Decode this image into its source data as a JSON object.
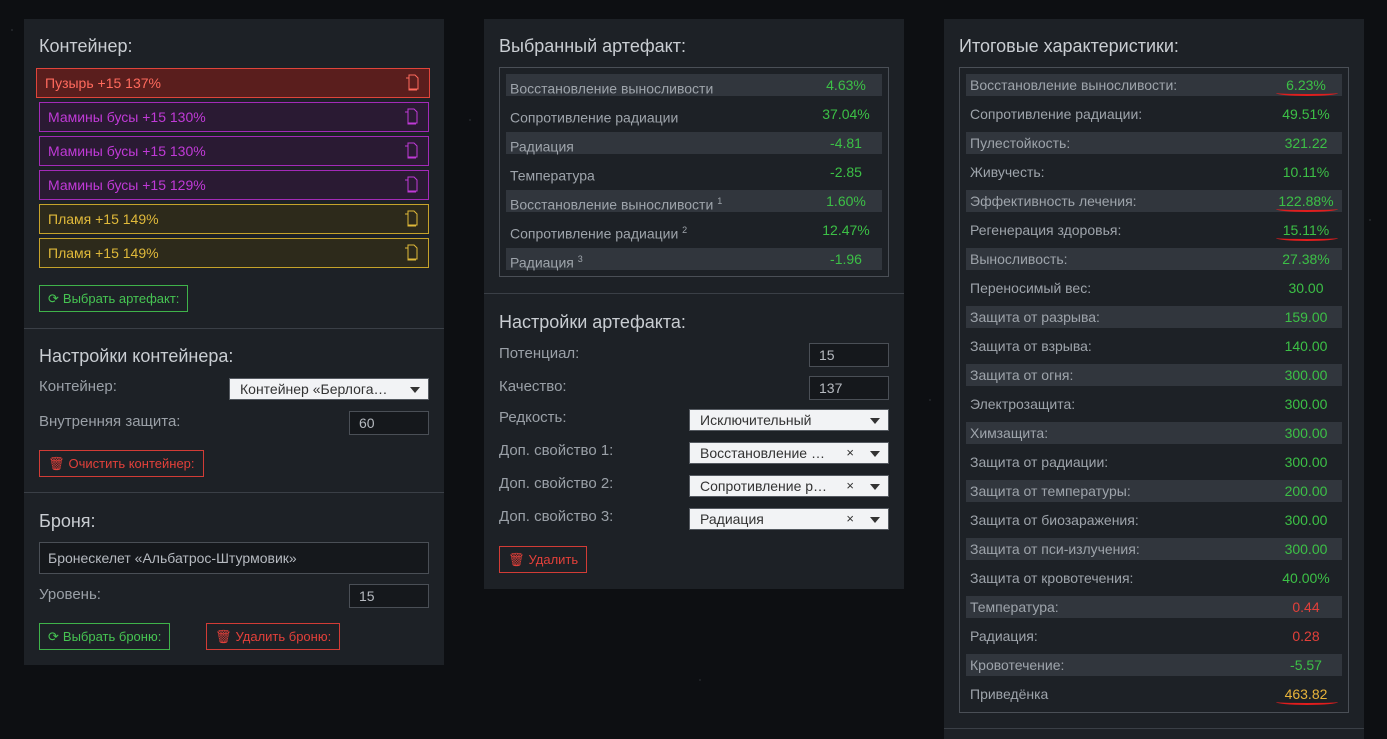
{
  "container": {
    "title": "Контейнер:",
    "artifacts": [
      {
        "label": "Пузырь +15 137%",
        "color": "red"
      },
      {
        "label": "Мамины бусы +15 130%",
        "color": "purple"
      },
      {
        "label": "Мамины бусы +15 130%",
        "color": "purple"
      },
      {
        "label": "Мамины бусы +15 129%",
        "color": "purple"
      },
      {
        "label": "Пламя +15 149%",
        "color": "gold"
      },
      {
        "label": "Пламя +15 149%",
        "color": "gold"
      }
    ],
    "select_artifact_button": "Выбрать артефакт:"
  },
  "container_settings": {
    "title": "Настройки контейнера:",
    "container_label": "Контейнер:",
    "container_value": "Контейнер «Берлога…",
    "protection_label": "Внутренняя защита:",
    "protection_value": "60",
    "clear_button": "Очистить контейнер:"
  },
  "armor": {
    "title": "Броня:",
    "value": "Бронескелет «Альбатрос-Штурмовик»",
    "level_label": "Уровень:",
    "level_value": "15",
    "select_button": "Выбрать броню:",
    "delete_button": "Удалить броню:"
  },
  "selected_artifact": {
    "title": "Выбранный артефакт:",
    "rows": [
      {
        "key": "Восстановление выносливости",
        "sup": "",
        "value": "4.63%",
        "tone": "g"
      },
      {
        "key": "Сопротивление радиации",
        "sup": "",
        "value": "37.04%",
        "tone": "g"
      },
      {
        "key": "Радиация",
        "sup": "",
        "value": "-4.81",
        "tone": "g"
      },
      {
        "key": "Температура",
        "sup": "",
        "value": "-2.85",
        "tone": "g"
      },
      {
        "key": "Восстановление выносливости",
        "sup": "1",
        "value": "1.60%",
        "tone": "g"
      },
      {
        "key": "Сопротивление радиации",
        "sup": "2",
        "value": "12.47%",
        "tone": "g"
      },
      {
        "key": "Радиация",
        "sup": "3",
        "value": "-1.96",
        "tone": "g"
      }
    ]
  },
  "artifact_settings": {
    "title": "Настройки артефакта:",
    "potential_label": "Потенциал:",
    "potential_value": "15",
    "quality_label": "Качество:",
    "quality_value": "137",
    "rarity_label": "Редкость:",
    "rarity_value": "Исключительный",
    "prop1_label": "Доп. свойство 1:",
    "prop1_value": "Восстановление в…",
    "prop2_label": "Доп. свойство 2:",
    "prop2_value": "Сопротивление р…",
    "prop3_label": "Доп. свойство 3:",
    "prop3_value": "Радиация",
    "clear_symbol": "×",
    "delete_button": "Удалить"
  },
  "totals": {
    "title": "Итоговые характеристики:",
    "rows": [
      {
        "key": "Восстановление выносливости:",
        "value": "6.23%",
        "tone": "g",
        "mark": true
      },
      {
        "key": "Сопротивление радиации:",
        "value": "49.51%",
        "tone": "g",
        "mark": false
      },
      {
        "key": "Пулестойкость:",
        "value": "321.22",
        "tone": "g",
        "mark": false
      },
      {
        "key": "Живучесть:",
        "value": "10.11%",
        "tone": "g",
        "mark": false
      },
      {
        "key": "Эффективность лечения:",
        "value": "122.88%",
        "tone": "g",
        "mark": true
      },
      {
        "key": "Регенерация здоровья:",
        "value": "15.11%",
        "tone": "g",
        "mark": true
      },
      {
        "key": "Выносливость:",
        "value": "27.38%",
        "tone": "g",
        "mark": false
      },
      {
        "key": "Переносимый вес:",
        "value": "30.00",
        "tone": "g",
        "mark": false
      },
      {
        "key": "Защита от разрыва:",
        "value": "159.00",
        "tone": "g",
        "mark": false
      },
      {
        "key": "Защита от взрыва:",
        "value": "140.00",
        "tone": "g",
        "mark": false
      },
      {
        "key": "Защита от огня:",
        "value": "300.00",
        "tone": "g",
        "mark": false
      },
      {
        "key": "Электрозащита:",
        "value": "300.00",
        "tone": "g",
        "mark": false
      },
      {
        "key": "Химзащита:",
        "value": "300.00",
        "tone": "g",
        "mark": false
      },
      {
        "key": "Защита от радиации:",
        "value": "300.00",
        "tone": "g",
        "mark": false
      },
      {
        "key": "Защита от температуры:",
        "value": "200.00",
        "tone": "g",
        "mark": false
      },
      {
        "key": "Защита от биозаражения:",
        "value": "300.00",
        "tone": "g",
        "mark": false
      },
      {
        "key": "Защита от пси-излучения:",
        "value": "300.00",
        "tone": "g",
        "mark": false
      },
      {
        "key": "Защита от кровотечения:",
        "value": "40.00%",
        "tone": "g",
        "mark": false
      },
      {
        "key": "Температура:",
        "value": "0.44",
        "tone": "r",
        "mark": false
      },
      {
        "key": "Радиация:",
        "value": "0.28",
        "tone": "r",
        "mark": false
      },
      {
        "key": "Кровотечение:",
        "value": "-5.57",
        "tone": "g",
        "mark": false
      },
      {
        "key": "Приведёнка",
        "value": "463.82",
        "tone": "y",
        "mark": true
      }
    ]
  },
  "colors": {
    "panel": "#1d2126",
    "green": "#3cc046",
    "red": "#e2403a",
    "gold": "#e8b43a",
    "purple": "#c03ad7"
  }
}
